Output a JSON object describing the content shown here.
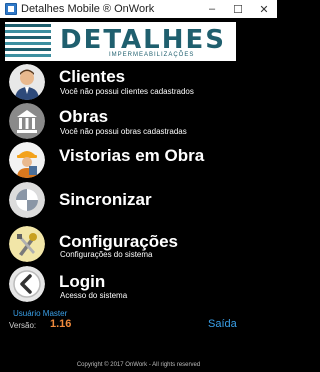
{
  "window": {
    "title": "Detalhes Mobile ® OnWork",
    "minimize": "–",
    "maximize": "☐",
    "close": "✕"
  },
  "logo": {
    "brand": "DETALHES",
    "subtitle": "IMPERMEABILIZAÇÕES"
  },
  "menu": [
    {
      "label": "Clientes",
      "sub": "Você não possui clientes cadastrados",
      "icon": "person-icon"
    },
    {
      "label": "Obras",
      "sub": "Você não possui obras cadastradas",
      "icon": "building-icon"
    },
    {
      "label": "Vistorias em Obra",
      "sub": "",
      "icon": "inspector-icon"
    },
    {
      "label": "Sincronizar",
      "sub": "",
      "icon": "sync-icon"
    },
    {
      "label": "Configurações",
      "sub": "Configurações do sistema",
      "icon": "tools-icon"
    },
    {
      "label": "Login",
      "sub": "Acesso do sistema",
      "icon": "back-arrow-icon"
    }
  ],
  "footer": {
    "user": "Usuário Master",
    "version_label": "Versão:",
    "version": "1.16",
    "exit": "Saída",
    "copyright": "Copyright © 2017 OnWork - All rights reserved"
  },
  "colors": {
    "background": "#000000",
    "link": "#3aa0e8",
    "version": "#f08a3c",
    "brand": "#1f5f6e"
  }
}
